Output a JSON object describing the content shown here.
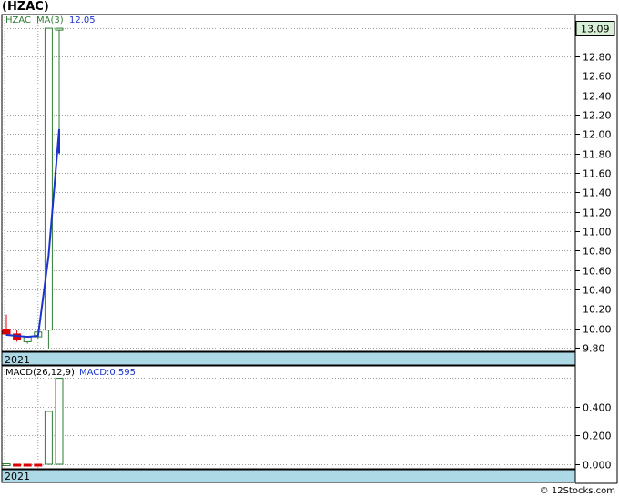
{
  "title": "(HZAC)",
  "copyright": "© 12Stocks.com",
  "price_panel": {
    "ticker_label": "HZAC",
    "ma_label": "MA(3)",
    "ma_value": "12.05",
    "last_price_badge": "13.09",
    "year_label": "2021",
    "y_ticks": [
      "12.80",
      "12.60",
      "12.40",
      "12.20",
      "12.00",
      "11.80",
      "11.60",
      "11.40",
      "11.20",
      "11.00",
      "10.80",
      "10.60",
      "10.40",
      "10.20",
      "10.00",
      "9.80"
    ]
  },
  "macd_panel": {
    "label": "MACD(26,12,9)",
    "value_label": "MACD:0.595",
    "year_label": "2021",
    "y_ticks": [
      "0.400",
      "0.200",
      "0.000"
    ]
  },
  "colors": {
    "up": "#2e7d32",
    "down": "#dd0000",
    "ma_line": "#1a33cc",
    "year_band": "#add8e6",
    "grid": "#a0a0a0",
    "badge_fill": "#d8f0d8"
  },
  "chart_data": [
    {
      "type": "candlestick",
      "title": "(HZAC)",
      "ylim": [
        9.7,
        13.2
      ],
      "candles": [
        {
          "open": 9.99,
          "high": 10.14,
          "low": 9.92,
          "close": 9.94,
          "direction": "down"
        },
        {
          "open": 9.94,
          "high": 9.98,
          "low": 9.86,
          "close": 9.88,
          "direction": "down"
        },
        {
          "open": 9.86,
          "high": 9.92,
          "low": 9.84,
          "close": 9.91,
          "direction": "up"
        },
        {
          "open": 9.91,
          "high": 9.99,
          "low": 9.89,
          "close": 9.96,
          "direction": "up"
        },
        {
          "open": 9.98,
          "high": 13.09,
          "low": 9.79,
          "close": 13.09,
          "direction": "up"
        },
        {
          "open": 13.09,
          "high": 13.09,
          "low": 11.8,
          "close": 13.09,
          "direction": "up"
        }
      ],
      "ma_series": {
        "name": "MA(3)",
        "values": [
          9.93,
          9.92,
          9.91,
          9.92,
          10.75,
          12.05
        ],
        "end_tick": 11.8
      }
    },
    {
      "type": "bar",
      "title": "MACD(26,12,9)",
      "ylim": [
        -0.03,
        0.64
      ],
      "values": [
        0.003,
        -0.01,
        -0.011,
        -0.012,
        0.366,
        0.595
      ],
      "direction": [
        "up",
        "down",
        "down",
        "down",
        "up",
        "up"
      ]
    }
  ]
}
